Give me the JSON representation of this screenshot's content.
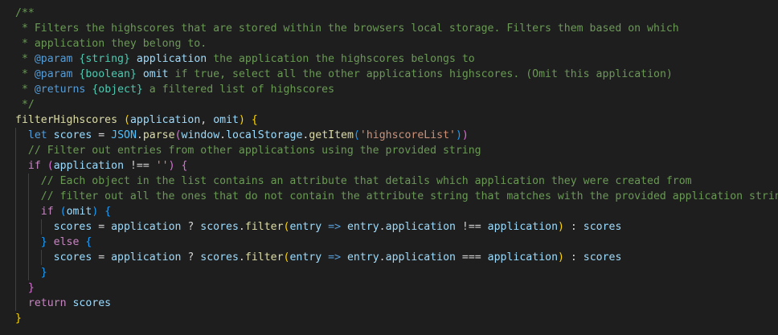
{
  "editor": {
    "language": "javascript",
    "lines": [
      {
        "indent": 0,
        "tokens": [
          [
            "/**",
            "comment"
          ]
        ]
      },
      {
        "indent": 0,
        "tokens": [
          [
            " * Filters the highscores that are stored within the browsers local storage. Filters them based on which",
            "comment"
          ]
        ]
      },
      {
        "indent": 0,
        "tokens": [
          [
            " * application they belong to.",
            "comment"
          ]
        ]
      },
      {
        "indent": 0,
        "tokens": [
          [
            " * ",
            "comment"
          ],
          [
            "@param",
            "doctag"
          ],
          [
            " ",
            "comment"
          ],
          [
            "{string}",
            "doctype"
          ],
          [
            " ",
            "comment"
          ],
          [
            "application",
            "docparam"
          ],
          [
            " the application the highscores belongs to",
            "comment"
          ]
        ]
      },
      {
        "indent": 0,
        "tokens": [
          [
            " * ",
            "comment"
          ],
          [
            "@param",
            "doctag"
          ],
          [
            " ",
            "comment"
          ],
          [
            "{boolean}",
            "doctype"
          ],
          [
            " ",
            "comment"
          ],
          [
            "omit",
            "docparam"
          ],
          [
            " if true, select all the other applications highscores. (Omit this application)",
            "comment"
          ]
        ]
      },
      {
        "indent": 0,
        "tokens": [
          [
            " * ",
            "comment"
          ],
          [
            "@returns",
            "doctag"
          ],
          [
            " ",
            "comment"
          ],
          [
            "{object}",
            "doctype"
          ],
          [
            " a filtered list of highscores",
            "comment"
          ]
        ]
      },
      {
        "indent": 0,
        "tokens": [
          [
            " */",
            "comment"
          ]
        ]
      },
      {
        "indent": 0,
        "tokens": [
          [
            "filterHighscores",
            "func"
          ],
          [
            " ",
            "plain"
          ],
          [
            "(",
            "b1"
          ],
          [
            "application",
            "var"
          ],
          [
            ", ",
            "plain"
          ],
          [
            "omit",
            "var"
          ],
          [
            ")",
            "b1"
          ],
          [
            " ",
            "plain"
          ],
          [
            "{",
            "b1"
          ]
        ]
      },
      {
        "indent": 1,
        "tokens": [
          [
            "let",
            "decl"
          ],
          [
            " ",
            "plain"
          ],
          [
            "scores",
            "var"
          ],
          [
            " = ",
            "op"
          ],
          [
            "JSON",
            "cls"
          ],
          [
            ".",
            "plain"
          ],
          [
            "parse",
            "func"
          ],
          [
            "(",
            "b2"
          ],
          [
            "window",
            "var"
          ],
          [
            ".",
            "plain"
          ],
          [
            "localStorage",
            "var"
          ],
          [
            ".",
            "plain"
          ],
          [
            "getItem",
            "func"
          ],
          [
            "(",
            "b3"
          ],
          [
            "'highscoreList'",
            "str"
          ],
          [
            ")",
            "b3"
          ],
          [
            ")",
            "b2"
          ]
        ]
      },
      {
        "indent": 1,
        "tokens": [
          [
            "// Filter out entries from other applications using the provided string",
            "comment"
          ]
        ]
      },
      {
        "indent": 1,
        "tokens": [
          [
            "if",
            "kw"
          ],
          [
            " ",
            "plain"
          ],
          [
            "(",
            "b2"
          ],
          [
            "application",
            "var"
          ],
          [
            " !== ",
            "op"
          ],
          [
            "''",
            "str"
          ],
          [
            ")",
            "b2"
          ],
          [
            " ",
            "plain"
          ],
          [
            "{",
            "b2"
          ]
        ]
      },
      {
        "indent": 2,
        "tokens": [
          [
            "// Each object in the list contains an attribute that details which application they were created from",
            "comment"
          ]
        ]
      },
      {
        "indent": 2,
        "tokens": [
          [
            "// filter out all the ones that do not contain the attribute string that matches with the provided application string.",
            "comment"
          ]
        ]
      },
      {
        "indent": 2,
        "tokens": [
          [
            "if",
            "kw"
          ],
          [
            " ",
            "plain"
          ],
          [
            "(",
            "b3"
          ],
          [
            "omit",
            "var"
          ],
          [
            ")",
            "b3"
          ],
          [
            " ",
            "plain"
          ],
          [
            "{",
            "b3"
          ]
        ]
      },
      {
        "indent": 3,
        "tokens": [
          [
            "scores",
            "var"
          ],
          [
            " = ",
            "op"
          ],
          [
            "application",
            "var"
          ],
          [
            " ? ",
            "op"
          ],
          [
            "scores",
            "var"
          ],
          [
            ".",
            "plain"
          ],
          [
            "filter",
            "func"
          ],
          [
            "(",
            "b1"
          ],
          [
            "entry",
            "var"
          ],
          [
            " ",
            "plain"
          ],
          [
            "=>",
            "arrow"
          ],
          [
            " ",
            "plain"
          ],
          [
            "entry",
            "var"
          ],
          [
            ".",
            "plain"
          ],
          [
            "application",
            "var"
          ],
          [
            " !== ",
            "op"
          ],
          [
            "application",
            "var"
          ],
          [
            ")",
            "b1"
          ],
          [
            " : ",
            "op"
          ],
          [
            "scores",
            "var"
          ]
        ]
      },
      {
        "indent": 2,
        "tokens": [
          [
            "}",
            "b3"
          ],
          [
            " ",
            "plain"
          ],
          [
            "else",
            "kw"
          ],
          [
            " ",
            "plain"
          ],
          [
            "{",
            "b3"
          ]
        ]
      },
      {
        "indent": 3,
        "tokens": [
          [
            "scores",
            "var"
          ],
          [
            " = ",
            "op"
          ],
          [
            "application",
            "var"
          ],
          [
            " ? ",
            "op"
          ],
          [
            "scores",
            "var"
          ],
          [
            ".",
            "plain"
          ],
          [
            "filter",
            "func"
          ],
          [
            "(",
            "b1"
          ],
          [
            "entry",
            "var"
          ],
          [
            " ",
            "plain"
          ],
          [
            "=>",
            "arrow"
          ],
          [
            " ",
            "plain"
          ],
          [
            "entry",
            "var"
          ],
          [
            ".",
            "plain"
          ],
          [
            "application",
            "var"
          ],
          [
            " === ",
            "op"
          ],
          [
            "application",
            "var"
          ],
          [
            ")",
            "b1"
          ],
          [
            " : ",
            "op"
          ],
          [
            "scores",
            "var"
          ]
        ]
      },
      {
        "indent": 2,
        "tokens": [
          [
            "}",
            "b3"
          ]
        ]
      },
      {
        "indent": 1,
        "tokens": [
          [
            "}",
            "b2"
          ]
        ]
      },
      {
        "indent": 1,
        "tokens": [
          [
            "return",
            "kw"
          ],
          [
            " ",
            "plain"
          ],
          [
            "scores",
            "var"
          ]
        ]
      },
      {
        "indent": 0,
        "tokens": [
          [
            "}",
            "b1"
          ]
        ]
      }
    ]
  },
  "colors": {
    "background": "#1e1e1e",
    "comment": "#6a9955",
    "keyword": "#c586c0",
    "function": "#dcdcaa",
    "variable": "#9cdcfe",
    "string": "#ce9178",
    "bracket_gold": "#ffd700",
    "bracket_orchid": "#da70d6",
    "bracket_blue": "#179fff"
  }
}
